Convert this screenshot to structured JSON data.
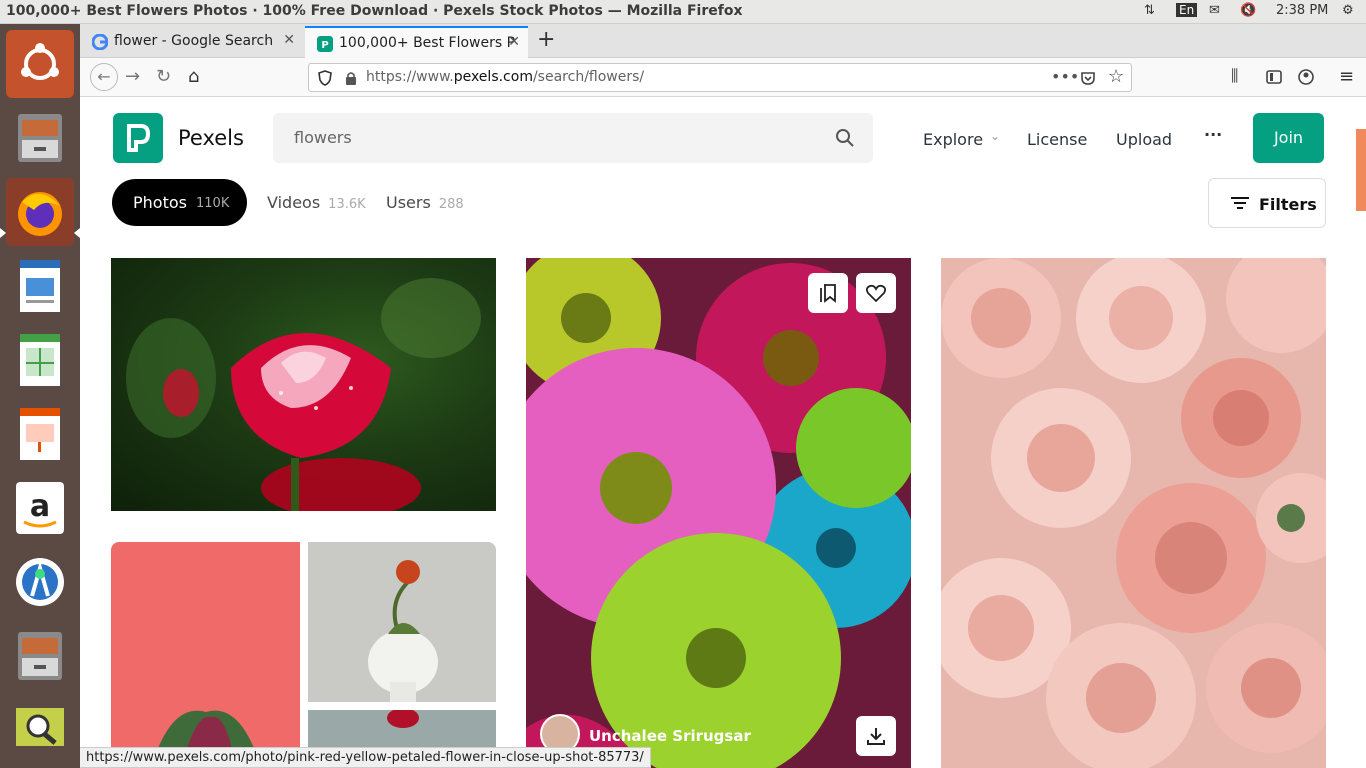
{
  "os": {
    "window_title": "100,000+ Best Flowers Photos · 100% Free Download · Pexels Stock Photos — Mozilla Firefox",
    "lang": "En",
    "time": "2:38 PM"
  },
  "launcher": {
    "items": [
      "ubuntu-dash",
      "files",
      "firefox",
      "writer",
      "calc",
      "impress",
      "amazon",
      "android-studio",
      "files-2",
      "image-viewer"
    ]
  },
  "browser": {
    "tabs": [
      {
        "label": "flower - Google Search"
      },
      {
        "label": "100,000+ Best Flowers P"
      }
    ],
    "url_prefix": "https://www.",
    "url_domain": "pexels.com",
    "url_path": "/search/flowers/",
    "status_url": "https://www.pexels.com/photo/pink-red-yellow-petaled-flower-in-close-up-shot-85773/"
  },
  "pexels": {
    "brand": "Pexels",
    "search_value": "flowers",
    "nav": {
      "explore": "Explore",
      "license": "License",
      "upload": "Upload",
      "join": "Join"
    },
    "media_tabs": [
      {
        "label": "Photos",
        "count": "110K"
      },
      {
        "label": "Videos",
        "count": "13.6K"
      },
      {
        "label": "Users",
        "count": "288"
      }
    ],
    "filters": "Filters",
    "photographer": "Unchalee Srirugsar"
  },
  "colors": {
    "brand": "#05a081",
    "accent": "#f08a5d"
  }
}
